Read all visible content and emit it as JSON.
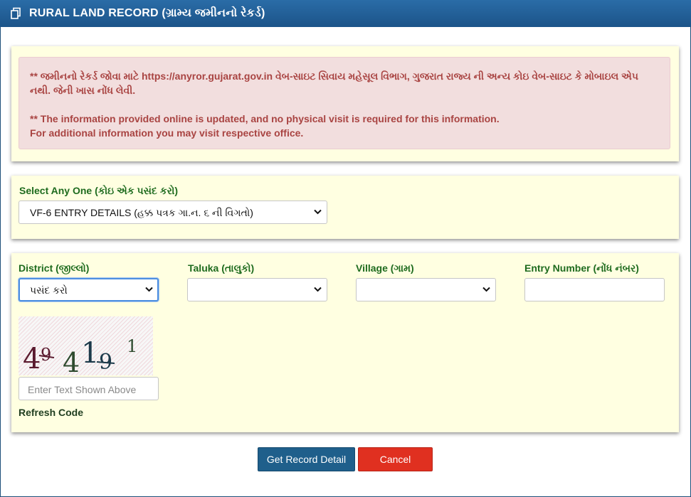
{
  "header": {
    "title": "RURAL LAND RECORD (ગ્રામ્ય જમીનનો રેકર્ડ)",
    "icon": "copy-icon"
  },
  "notice": {
    "line1": "** જમીનનો રેકર્ડ જોવા માટે https://anyror.gujarat.gov.in વેબ-સાઇટ સિવાય મહેસૂલ વિભાગ, ગુજરાત રાજ્ય ની અન્ય કોઇ વેબ-સાઇટ કે મોબાઇલ એપ",
    "line2": "નથી. જેની ખાસ નોંધ લેવી.",
    "line3": "** The information provided online is updated, and no physical visit is required for this information.",
    "line4": "For additional information you may visit respective office."
  },
  "select_any": {
    "label": "Select Any One (કોઇ એક પસંદ કરો)",
    "selected": "VF-6 ENTRY DETAILS (હક્ક પત્રક ગા.ન. ૬ ની વિગતો)"
  },
  "form": {
    "district_label": "District (જીલ્લો)",
    "district_value": "પસંદ કરો",
    "taluka_label": "Taluka (તાલુકો)",
    "taluka_value": "",
    "village_label": "Village (ગામ)",
    "village_value": "",
    "entry_label": "Entry Number (નોંધ નંબર)",
    "entry_value": "",
    "captcha_text": "49 4191",
    "captcha_placeholder": "Enter Text Shown Above",
    "refresh_label": "Refresh Code"
  },
  "buttons": {
    "get": "Get Record Detail",
    "cancel": "Cancel"
  },
  "colors": {
    "header_bg": "#1c5489",
    "panel_bg": "#ffffe1",
    "alert_text": "#a94442",
    "label_green": "#1e6b1e",
    "primary_button": "#1f5f8b",
    "danger_button": "#e03020"
  }
}
